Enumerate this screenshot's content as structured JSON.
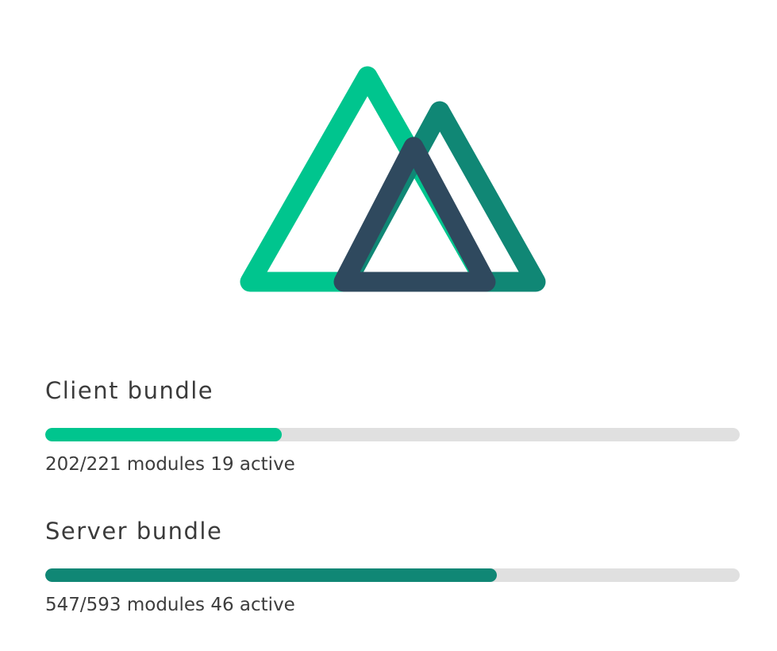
{
  "logo": {
    "colors": {
      "primary": "#00c58e",
      "secondary": "#108775",
      "tertiary": "#2f495e"
    }
  },
  "bundles": [
    {
      "title": "Client bundle",
      "progress_percent": 34,
      "color": "#00c58e",
      "stats": "202/221 modules 19 active"
    },
    {
      "title": "Server bundle",
      "progress_percent": 65,
      "color": "#108775",
      "stats": "547/593 modules 46 active"
    }
  ]
}
